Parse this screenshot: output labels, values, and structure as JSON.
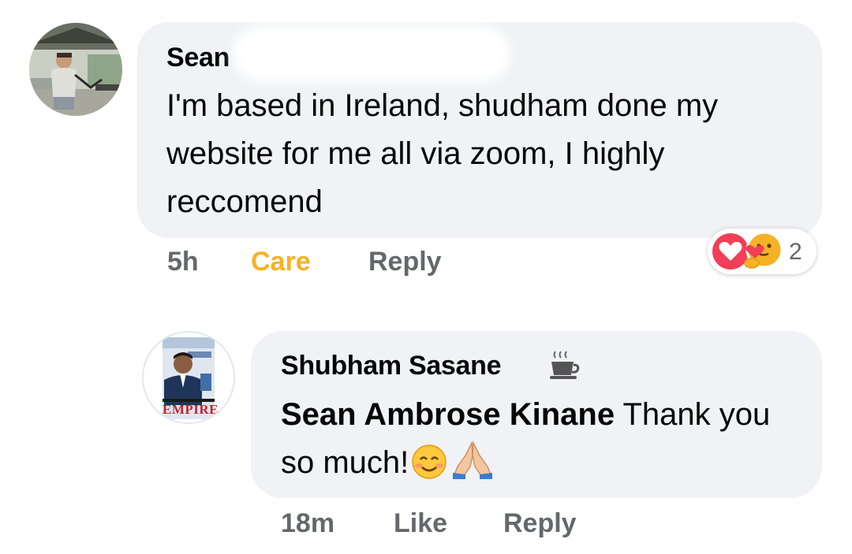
{
  "comment": {
    "author": "Sean",
    "text": "I'm based in Ireland, shudham done my website for me all via zoom, I highly reccomend",
    "time": "5h",
    "reaction_label": "Care",
    "reply_label": "Reply",
    "reactions": {
      "types": [
        "love",
        "care"
      ],
      "count": "2"
    }
  },
  "reply": {
    "author": "Shubham Sasane",
    "badge_icon": "coffee-cup-icon",
    "mention": "Sean Ambrose Kinane",
    "text": "Thank you so much!",
    "emojis": [
      "smiling-face-icon",
      "folded-hands-icon"
    ],
    "time": "18m",
    "like_label": "Like",
    "reply_label": "Reply",
    "avatar_text": "EMPIRE"
  },
  "colors": {
    "bubble": "#f0f2f5",
    "meta_text": "#65676b",
    "care_active": "#f7b125"
  }
}
